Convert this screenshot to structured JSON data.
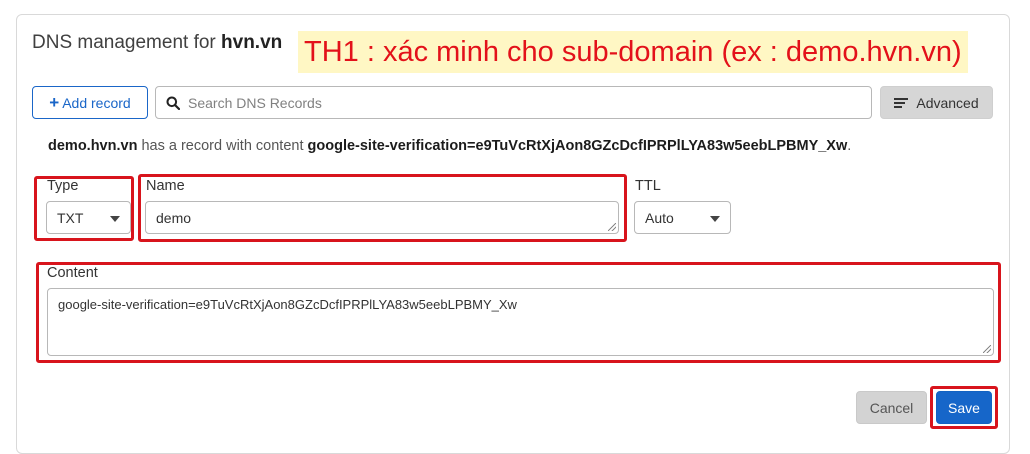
{
  "header": {
    "title_prefix": "DNS management for ",
    "domain": "hvn.vn"
  },
  "annotation": {
    "note": "TH1 : xác minh cho sub-domain (ex : demo.hvn.vn)"
  },
  "toolbar": {
    "add_plus": "+",
    "add_label": "Add record",
    "search_placeholder": "Search DNS Records",
    "advanced_label": "Advanced"
  },
  "record_info": {
    "name": "demo.hvn.vn",
    "middle": " has a record with content ",
    "content": "google-site-verification=e9TuVcRtXjAon8GZcDcfIPRPlLYA83w5eebLPBMY_Xw",
    "end": "."
  },
  "form": {
    "type_label": "Type",
    "type_value": "TXT",
    "name_label": "Name",
    "name_value": "demo",
    "ttl_label": "TTL",
    "ttl_value": "Auto",
    "content_label": "Content",
    "content_value": "google-site-verification=e9TuVcRtXjAon8GZcDcfIPRPlLYA83w5eebLPBMY_Xw"
  },
  "actions": {
    "cancel_label": "Cancel",
    "save_label": "Save"
  },
  "colors": {
    "primary": "#1666c9",
    "highlight": "#d8141c",
    "annotation_text": "#e3111a",
    "annotation_bg": "#fff7c4"
  }
}
